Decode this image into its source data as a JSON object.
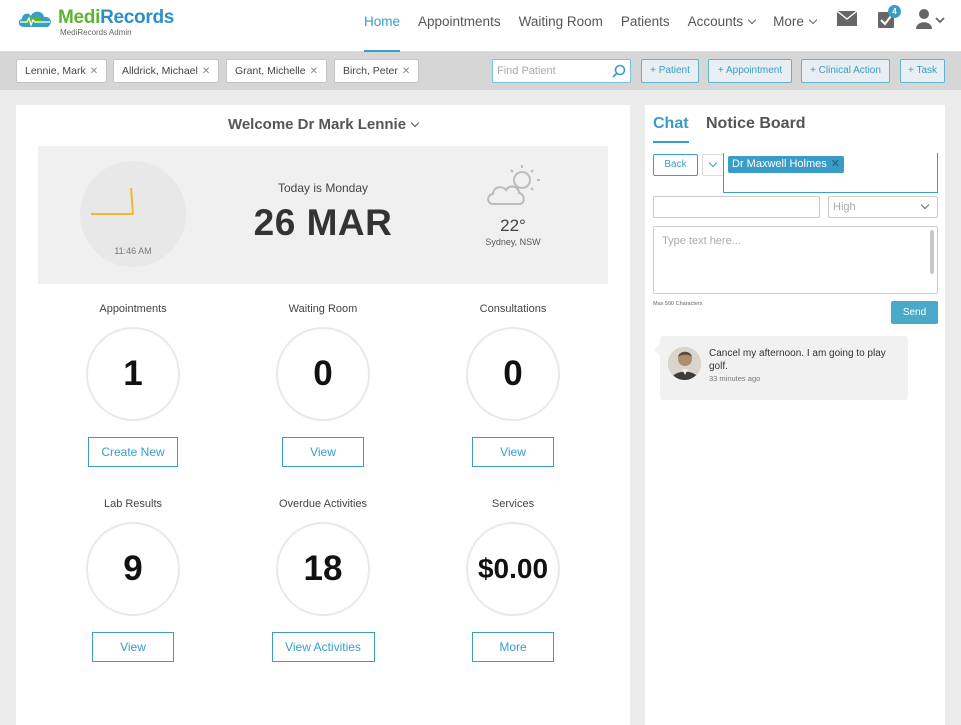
{
  "brand": {
    "name_part1": "Medi",
    "name_part2": "Records",
    "subtitle": "MediRecords Admin"
  },
  "nav": {
    "items": [
      {
        "label": "Home",
        "active": true,
        "dropdown": false
      },
      {
        "label": "Appointments",
        "active": false,
        "dropdown": false
      },
      {
        "label": "Waiting Room",
        "active": false,
        "dropdown": false
      },
      {
        "label": "Patients",
        "active": false,
        "dropdown": false
      },
      {
        "label": "Accounts",
        "active": false,
        "dropdown": true
      },
      {
        "label": "More",
        "active": false,
        "dropdown": true
      }
    ],
    "tasks_badge": "4",
    "icons": [
      "mail-icon",
      "tasks-icon",
      "user-icon"
    ]
  },
  "patient_tabs": [
    {
      "label": "Lennie, Mark"
    },
    {
      "label": "Alldrick, Michael"
    },
    {
      "label": "Grant, Michelle"
    },
    {
      "label": "Birch, Peter"
    }
  ],
  "search": {
    "placeholder": "Find Patient",
    "value": ""
  },
  "quick_actions": {
    "patient": "+ Patient",
    "appointment": "+ Appointment",
    "clinical_action": "+ Clinical Action",
    "task": "+ Task"
  },
  "welcome": {
    "text": "Welcome Dr Mark Lennie"
  },
  "clock": {
    "time": "11:46 AM"
  },
  "date": {
    "today": "Today is Monday",
    "date": "26 MAR"
  },
  "weather": {
    "temperature": "22°",
    "location": "Sydney, NSW",
    "icon": "partly-cloudy-icon"
  },
  "stats": {
    "appointments": {
      "label": "Appointments",
      "value": "1",
      "button": "Create New"
    },
    "waiting_room": {
      "label": "Waiting Room",
      "value": "0",
      "button": "View"
    },
    "consultations": {
      "label": "Consultations",
      "value": "0",
      "button": "View"
    },
    "lab_results": {
      "label": "Lab Results",
      "value": "9",
      "button": "View"
    },
    "overdue": {
      "label": "Overdue Activities",
      "value": "18",
      "button": "View Activities"
    },
    "services": {
      "label": "Services",
      "value": "$0.00",
      "button": "More"
    }
  },
  "side": {
    "tabs": {
      "chat": "Chat",
      "notice": "Notice Board"
    },
    "back": "Back",
    "recipient": "Dr Maxwell Holmes",
    "subject": "",
    "priority": "High",
    "message_placeholder": "Type text here...",
    "max_chars": "Max 500 Characters",
    "send": "Send",
    "messages": [
      {
        "text": "Cancel my afternoon. I am going to play golf.",
        "time": "33 minutes ago"
      }
    ]
  },
  "colors": {
    "accent": "#3a9dc7",
    "brand_green": "#5cb531",
    "brand_blue": "#2d8fc4",
    "clock_hand": "#f2b632"
  }
}
